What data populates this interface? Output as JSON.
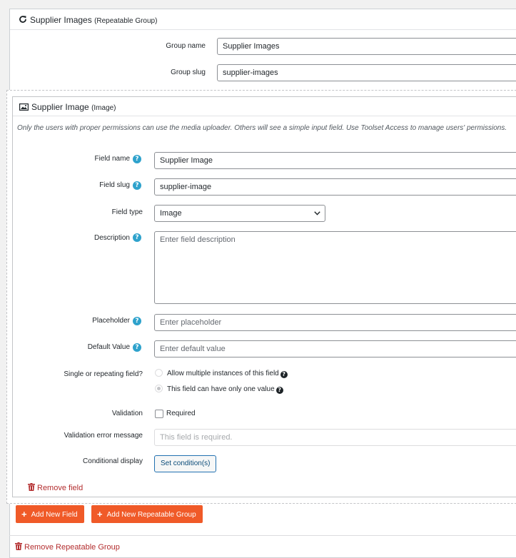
{
  "group": {
    "title": "Supplier Images",
    "type": "(Repeatable Group)",
    "name_label": "Group name",
    "name_value": "Supplier Images",
    "slug_label": "Group slug",
    "slug_value": "supplier-images"
  },
  "field": {
    "title": "Supplier Image",
    "type": "(Image)",
    "notice": "Only the users with proper permissions can use the media uploader. Others will see a simple input field. Use Toolset Access to manage users' permissions.",
    "name_label": "Field name",
    "name_value": "Supplier Image",
    "slug_label": "Field slug",
    "slug_value": "supplier-image",
    "type_label": "Field type",
    "type_value": "Image",
    "description_label": "Description",
    "description_placeholder": "Enter field description",
    "placeholder_label": "Placeholder",
    "placeholder_placeholder": "Enter placeholder",
    "default_label": "Default Value",
    "default_placeholder": "Enter default value",
    "repeat_label": "Single or repeating field?",
    "repeat_option_multiple": "Allow multiple instances of this field",
    "repeat_option_single": "This field can have only one value",
    "repeat_selected": "single",
    "validation_label": "Validation",
    "required_label": "Required",
    "error_label": "Validation error message",
    "error_placeholder": "This field is required.",
    "conditional_label": "Conditional display",
    "conditional_button": "Set condition(s)",
    "remove_field": "Remove field",
    "help_mark": "?"
  },
  "actions": {
    "add_field": "Add New Field",
    "add_group": "Add New Repeatable Group",
    "remove_group": "Remove Repeatable Group"
  },
  "colors": {
    "accent": "#f05a28",
    "help": "#2ea2cc",
    "danger": "#b32d2e"
  },
  "icons": [
    "refresh-icon",
    "image-icon",
    "help-icon",
    "chevron-down-icon",
    "trash-icon",
    "plus-icon"
  ]
}
